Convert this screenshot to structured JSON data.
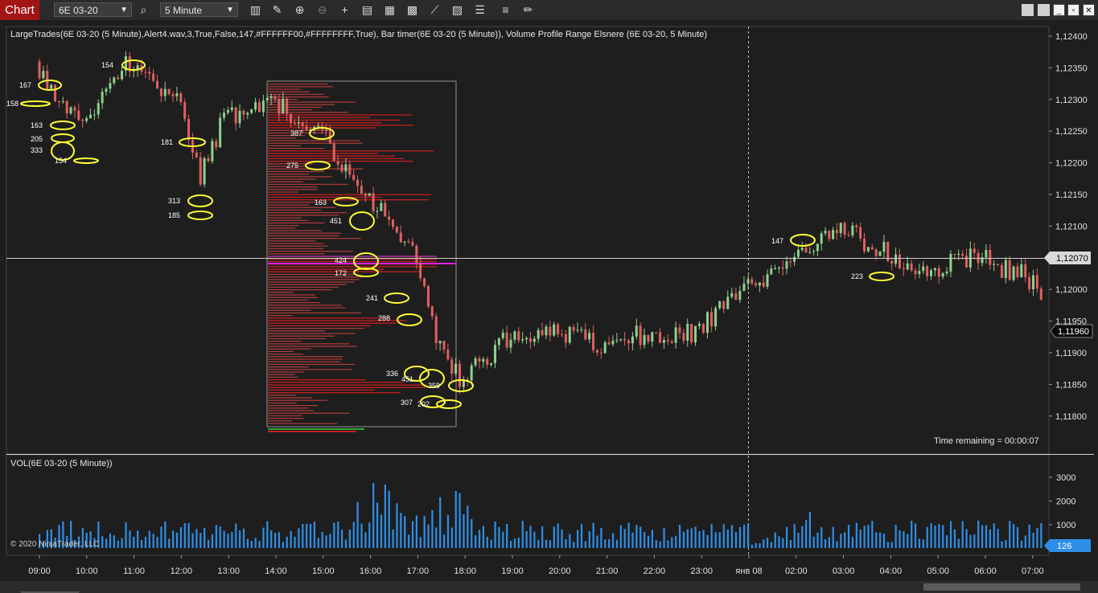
{
  "toolbar": {
    "chart_tab": "Chart",
    "instrument": "6E 03-20",
    "interval": "5 Minute"
  },
  "indicator_label": "LargeTrades(6E 03-20 (5 Minute),Alert4.wav,3,True,False,147,#FFFFFF00,#FFFFFFFF,True), Bar timer(6E 03-20 (5 Minute)), Volume Profile Range Elsnere (6E 03-20, 5 Minute)",
  "vol_label": "VOL(6E 03-20 (5 Minute))",
  "copyright": "© 2020 NinjaTrader, LLC",
  "time_remaining": "Time remaining = 00:00:07",
  "price_axis": [
    "1,12400",
    "1,12350",
    "1,12300",
    "1,12250",
    "1,12200",
    "1,12150",
    "1,12100",
    "1,12050",
    "1,12000",
    "1,11950",
    "1,11900",
    "1,11850",
    "1,11800"
  ],
  "crosshair_price": "1,12070",
  "last_price": "1,11960",
  "volume_axis": [
    "3000",
    "2000",
    "1000"
  ],
  "current_volume": "126",
  "time_axis": [
    "09:00",
    "10:00",
    "11:00",
    "12:00",
    "13:00",
    "14:00",
    "15:00",
    "16:00",
    "17:00",
    "18:00",
    "19:00",
    "20:00",
    "21:00",
    "22:00",
    "23:00",
    "янв 08",
    "02:00",
    "03:00",
    "04:00",
    "05:00",
    "06:00",
    "07:00"
  ],
  "large_trades": [
    "167",
    "158",
    "163",
    "205",
    "333",
    "154",
    "154",
    "181",
    "313",
    "185",
    "387",
    "275",
    "163",
    "451",
    "424",
    "172",
    "241",
    "288",
    "336",
    "451",
    "359",
    "307",
    "202",
    "147",
    "223"
  ],
  "colors": {
    "up_candle": "#8fd08f",
    "down_candle": "#e06060",
    "volume_bar": "#2e8fe8",
    "trade_ellipse": "#ffff33",
    "profile_bar": "#c04040",
    "chart_tab": "#a31515"
  },
  "chart_data": {
    "type": "candlestick",
    "instrument": "6E 03-20",
    "interval": "5 Minute",
    "price_range": [
      1.118,
      1.1242
    ],
    "volume_range": [
      0,
      3500
    ],
    "approx_close_path": [
      {
        "time": "09:00",
        "price": 1.1236
      },
      {
        "time": "10:00",
        "price": 1.1225
      },
      {
        "time": "11:00",
        "price": 1.1236
      },
      {
        "time": "12:00",
        "price": 1.123
      },
      {
        "time": "12:30",
        "price": 1.1218
      },
      {
        "time": "13:00",
        "price": 1.1227
      },
      {
        "time": "14:00",
        "price": 1.123
      },
      {
        "time": "15:00",
        "price": 1.1225
      },
      {
        "time": "16:00",
        "price": 1.1215
      },
      {
        "time": "17:00",
        "price": 1.1206
      },
      {
        "time": "17:30",
        "price": 1.1192
      },
      {
        "time": "18:00",
        "price": 1.1186
      },
      {
        "time": "19:00",
        "price": 1.1192
      },
      {
        "time": "20:00",
        "price": 1.1194
      },
      {
        "time": "21:00",
        "price": 1.1191
      },
      {
        "time": "22:00",
        "price": 1.1193
      },
      {
        "time": "23:00",
        "price": 1.1193
      },
      {
        "time": "00:00",
        "price": 1.12
      },
      {
        "time": "02:00",
        "price": 1.121
      },
      {
        "time": "03:00",
        "price": 1.1206
      },
      {
        "time": "04:00",
        "price": 1.1203
      },
      {
        "time": "05:00",
        "price": 1.1205
      },
      {
        "time": "06:00",
        "price": 1.1202
      },
      {
        "time": "07:00",
        "price": 1.1196
      }
    ]
  }
}
